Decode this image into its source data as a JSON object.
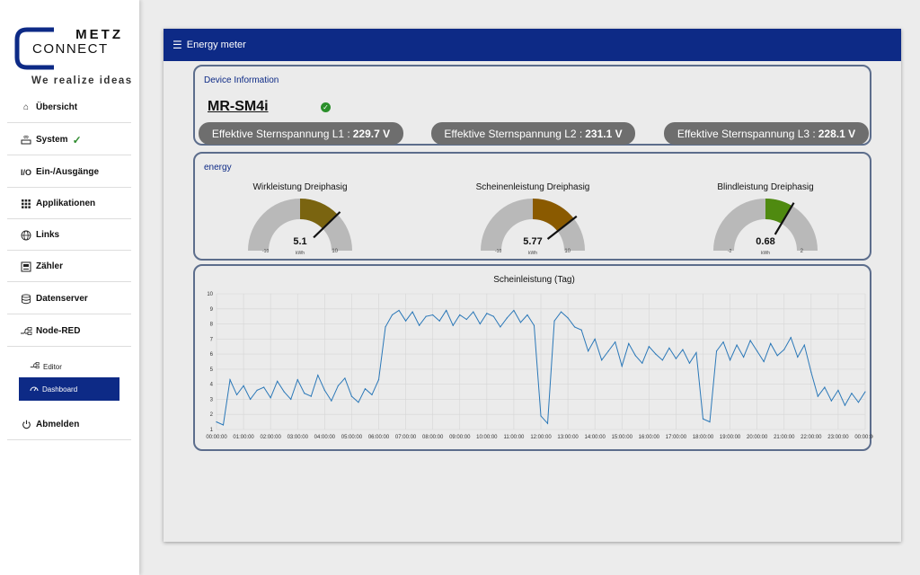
{
  "brand": {
    "metz": "METZ",
    "connect": "CONNECT",
    "tagline": "We realize ideas"
  },
  "sidebar": {
    "items": [
      {
        "label": "Übersicht",
        "icon": "home-icon"
      },
      {
        "label": "System",
        "icon": "router-icon",
        "checked": true
      },
      {
        "label": "Ein-/Ausgänge",
        "icon": "io-icon"
      },
      {
        "label": "Applikationen",
        "icon": "grid-icon"
      },
      {
        "label": "Links",
        "icon": "globe-icon"
      },
      {
        "label": "Zähler",
        "icon": "meter-icon"
      },
      {
        "label": "Datenserver",
        "icon": "database-icon"
      },
      {
        "label": "Node-RED",
        "icon": "node-red-icon"
      }
    ],
    "sub_items": [
      {
        "label": "Editor",
        "icon": "node-red-icon",
        "active": false
      },
      {
        "label": "Dashboard",
        "icon": "dashboard-icon",
        "active": true
      }
    ],
    "logout": {
      "label": "Abmelden",
      "icon": "power-icon"
    }
  },
  "topbar": {
    "title": "Energy meter",
    "menu_icon": "hamburger-icon"
  },
  "device_card": {
    "title": "Device Information",
    "device_name": "MR-SM4i",
    "status": "ok",
    "voltages": [
      {
        "label": "Effektive Sternspannung L1 :",
        "value": "229.7 V"
      },
      {
        "label": "Effektive Sternspannung L2 :",
        "value": "231.1 V"
      },
      {
        "label": "Effektive Sternspannung L3 :",
        "value": "228.1 V"
      }
    ]
  },
  "energy_card": {
    "title": "energy",
    "gauges": [
      {
        "title": "Wirkleistung Dreiphasig",
        "value": "5.1",
        "unit": "kWh",
        "min": "-10",
        "max": "10",
        "num": 5.1,
        "lo": -10,
        "hi": 10,
        "color": "#7a6410"
      },
      {
        "title": "Scheinenleistung Dreiphasig",
        "value": "5.77",
        "unit": "kWh",
        "min": "-10",
        "max": "10",
        "num": 5.77,
        "lo": -10,
        "hi": 10,
        "color": "#8a5a00"
      },
      {
        "title": "Blindleistung Dreiphasig",
        "value": "0.68",
        "unit": "kWh",
        "min": "-2",
        "max": "2",
        "num": 0.68,
        "lo": -2,
        "hi": 2,
        "color": "#4f8a10"
      }
    ]
  },
  "chart_card": {
    "chart_data": {
      "type": "line",
      "title": "Scheinleistung (Tag)",
      "xlabel": "",
      "ylabel": "",
      "ylim": [
        1,
        10
      ],
      "yticks": [
        1,
        2,
        3,
        4,
        5,
        6,
        7,
        8,
        9,
        10
      ],
      "xticks": [
        "00:00:00",
        "01:00:00",
        "02:00:00",
        "03:00:00",
        "04:00:00",
        "05:00:00",
        "06:00:00",
        "07:00:00",
        "08:00:00",
        "09:00:00",
        "10:00:00",
        "11:00:00",
        "12:00:00",
        "13:00:00",
        "14:00:00",
        "15:00:00",
        "16:00:00",
        "17:00:00",
        "18:00:00",
        "19:00:00",
        "20:00:00",
        "21:00:00",
        "22:00:00",
        "23:00:00",
        "00:00:00"
      ],
      "grid": true,
      "line_color": "#2b78b8",
      "x_hours": [
        0,
        0.25,
        0.5,
        0.75,
        1,
        1.25,
        1.5,
        1.75,
        2,
        2.25,
        2.5,
        2.75,
        3,
        3.25,
        3.5,
        3.75,
        4,
        4.25,
        4.5,
        4.75,
        5,
        5.25,
        5.5,
        5.75,
        6,
        6.25,
        6.5,
        6.75,
        7,
        7.25,
        7.5,
        7.75,
        8,
        8.25,
        8.5,
        8.75,
        9,
        9.25,
        9.5,
        9.75,
        10,
        10.25,
        10.5,
        10.75,
        11,
        11.25,
        11.5,
        11.75,
        12,
        12.25,
        12.5,
        12.75,
        13,
        13.25,
        13.5,
        13.75,
        14,
        14.25,
        14.5,
        14.75,
        15,
        15.25,
        15.5,
        15.75,
        16,
        16.25,
        16.5,
        16.75,
        17,
        17.25,
        17.5,
        17.75,
        18,
        18.25,
        18.5,
        18.75,
        19,
        19.25,
        19.5,
        19.75,
        20,
        20.25,
        20.5,
        20.75,
        21,
        21.25,
        21.5,
        21.75,
        22,
        22.25,
        22.5,
        22.75,
        23,
        23.25,
        23.5,
        23.75,
        24
      ],
      "values": [
        1.5,
        1.3,
        4.3,
        3.3,
        3.9,
        3.0,
        3.6,
        3.8,
        3.1,
        4.2,
        3.5,
        3.0,
        4.3,
        3.4,
        3.2,
        4.6,
        3.6,
        2.9,
        3.9,
        4.4,
        3.2,
        2.8,
        3.7,
        3.3,
        4.3,
        7.8,
        8.6,
        8.9,
        8.2,
        8.8,
        7.9,
        8.5,
        8.6,
        8.2,
        8.9,
        7.9,
        8.6,
        8.3,
        8.8,
        8.0,
        8.7,
        8.5,
        7.8,
        8.4,
        8.9,
        8.1,
        8.6,
        7.9,
        1.9,
        1.4,
        8.2,
        8.8,
        8.4,
        7.8,
        7.6,
        6.2,
        7.0,
        5.6,
        6.2,
        6.8,
        5.2,
        6.7,
        5.9,
        5.4,
        6.5,
        6.0,
        5.6,
        6.4,
        5.7,
        6.3,
        5.4,
        6.1,
        1.7,
        1.5,
        6.2,
        6.8,
        5.6,
        6.6,
        5.8,
        6.9,
        6.2,
        5.5,
        6.7,
        5.9,
        6.3,
        7.1,
        5.8,
        6.6,
        4.8,
        3.2,
        3.8,
        2.9,
        3.6,
        2.6,
        3.4,
        2.8,
        3.5
      ]
    }
  }
}
